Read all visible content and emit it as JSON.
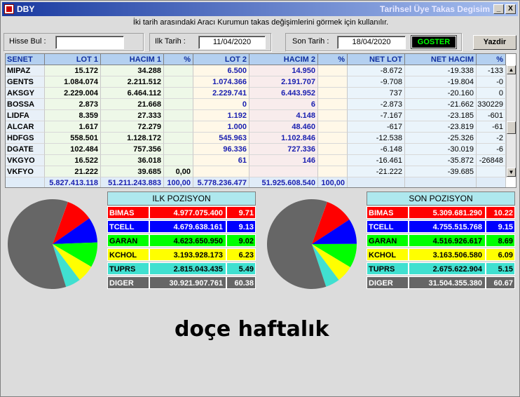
{
  "window": {
    "title": "DBY",
    "subtitle": "Tarihsel Üye Takas Degisim",
    "min_label": "_",
    "close_label": "X"
  },
  "info_text": "İki tarih arasındaki  Aracı Kurumun takas değişimlerini görmek için kullanılır.",
  "filters": {
    "hisse_label": "Hisse Bul :",
    "hisse_value": "",
    "ilk_tarih_label": "Ilk Tarih :",
    "ilk_tarih_value": "11/04/2020",
    "son_tarih_label": "Son Tarih :",
    "son_tarih_value": "18/04/2020",
    "goster_label": "GOSTER",
    "yazdir_label": "Yazdir"
  },
  "table": {
    "headers": [
      "SENET",
      "LOT 1",
      "HACIM 1",
      "%",
      "LOT 2",
      "HACIM 2",
      "%",
      "NET LOT",
      "NET HACIM",
      "%"
    ],
    "rows": [
      [
        "MIPAZ",
        "15.172",
        "34.288",
        "",
        "6.500",
        "14.950",
        "",
        "-8.672",
        "-19.338",
        "-133"
      ],
      [
        "GENTS",
        "1.084.074",
        "2.211.512",
        "",
        "1.074.366",
        "2.191.707",
        "",
        "-9.708",
        "-19.804",
        "-0"
      ],
      [
        "AKSGY",
        "2.229.004",
        "6.464.112",
        "",
        "2.229.741",
        "6.443.952",
        "",
        "737",
        "-20.160",
        "0"
      ],
      [
        "BOSSA",
        "2.873",
        "21.668",
        "",
        "0",
        "6",
        "",
        "-2.873",
        "-21.662",
        "330229"
      ],
      [
        "LIDFA",
        "8.359",
        "27.333",
        "",
        "1.192",
        "4.148",
        "",
        "-7.167",
        "-23.185",
        "-601"
      ],
      [
        "ALCAR",
        "1.617",
        "72.279",
        "",
        "1.000",
        "48.460",
        "",
        "-617",
        "-23.819",
        "-61"
      ],
      [
        "HDFGS",
        "558.501",
        "1.128.172",
        "",
        "545.963",
        "1.102.846",
        "",
        "-12.538",
        "-25.326",
        "-2"
      ],
      [
        "DGATE",
        "102.484",
        "757.356",
        "",
        "96.336",
        "727.336",
        "",
        "-6.148",
        "-30.019",
        "-6"
      ],
      [
        "VKGYO",
        "16.522",
        "36.018",
        "",
        "61",
        "146",
        "",
        "-16.461",
        "-35.872",
        "-26848"
      ],
      [
        "VKFYO",
        "21.222",
        "39.685",
        "0,00",
        "",
        "",
        "",
        "-21.222",
        "-39.685",
        ""
      ]
    ],
    "totals": [
      "",
      "5.827.413.118",
      "51.211.243.883",
      "100,00",
      "5.778.236.477",
      "51.925.608.540",
      "100,00",
      "",
      "",
      ""
    ]
  },
  "ilk_pozisyon": {
    "title": "ILK POZISYON",
    "rows": [
      {
        "name": "BIMAS",
        "value": "4.977.075.400",
        "pct": "9.71",
        "color": "#ff0000",
        "text": "#ffffff"
      },
      {
        "name": "TCELL",
        "value": "4.679.638.161",
        "pct": "9.13",
        "color": "#0000ff",
        "text": "#ffffff"
      },
      {
        "name": "GARAN",
        "value": "4.623.650.950",
        "pct": "9.02",
        "color": "#00ff00",
        "text": "#000000"
      },
      {
        "name": "KCHOL",
        "value": "3.193.928.173",
        "pct": "6.23",
        "color": "#ffff00",
        "text": "#000000"
      },
      {
        "name": "TUPRS",
        "value": "2.815.043.435",
        "pct": "5.49",
        "color": "#40e0d0",
        "text": "#000000"
      },
      {
        "name": "DIGER",
        "value": "30.921.907.761",
        "pct": "60.38",
        "color": "#666666",
        "text": "#ffffff"
      }
    ]
  },
  "son_pozisyon": {
    "title": "SON POZISYON",
    "rows": [
      {
        "name": "BIMAS",
        "value": "5.309.681.290",
        "pct": "10.22",
        "color": "#ff0000",
        "text": "#ffffff"
      },
      {
        "name": "TCELL",
        "value": "4.755.515.768",
        "pct": "9.15",
        "color": "#0000ff",
        "text": "#ffffff"
      },
      {
        "name": "GARAN",
        "value": "4.516.926.617",
        "pct": "8.69",
        "color": "#00ff00",
        "text": "#000000"
      },
      {
        "name": "KCHOL",
        "value": "3.163.506.580",
        "pct": "6.09",
        "color": "#ffff00",
        "text": "#000000"
      },
      {
        "name": "TUPRS",
        "value": "2.675.622.904",
        "pct": "5.15",
        "color": "#40e0d0",
        "text": "#000000"
      },
      {
        "name": "DIGER",
        "value": "31.504.355.380",
        "pct": "60.67",
        "color": "#666666",
        "text": "#ffffff"
      }
    ]
  },
  "caption": "doçe haftalık"
}
